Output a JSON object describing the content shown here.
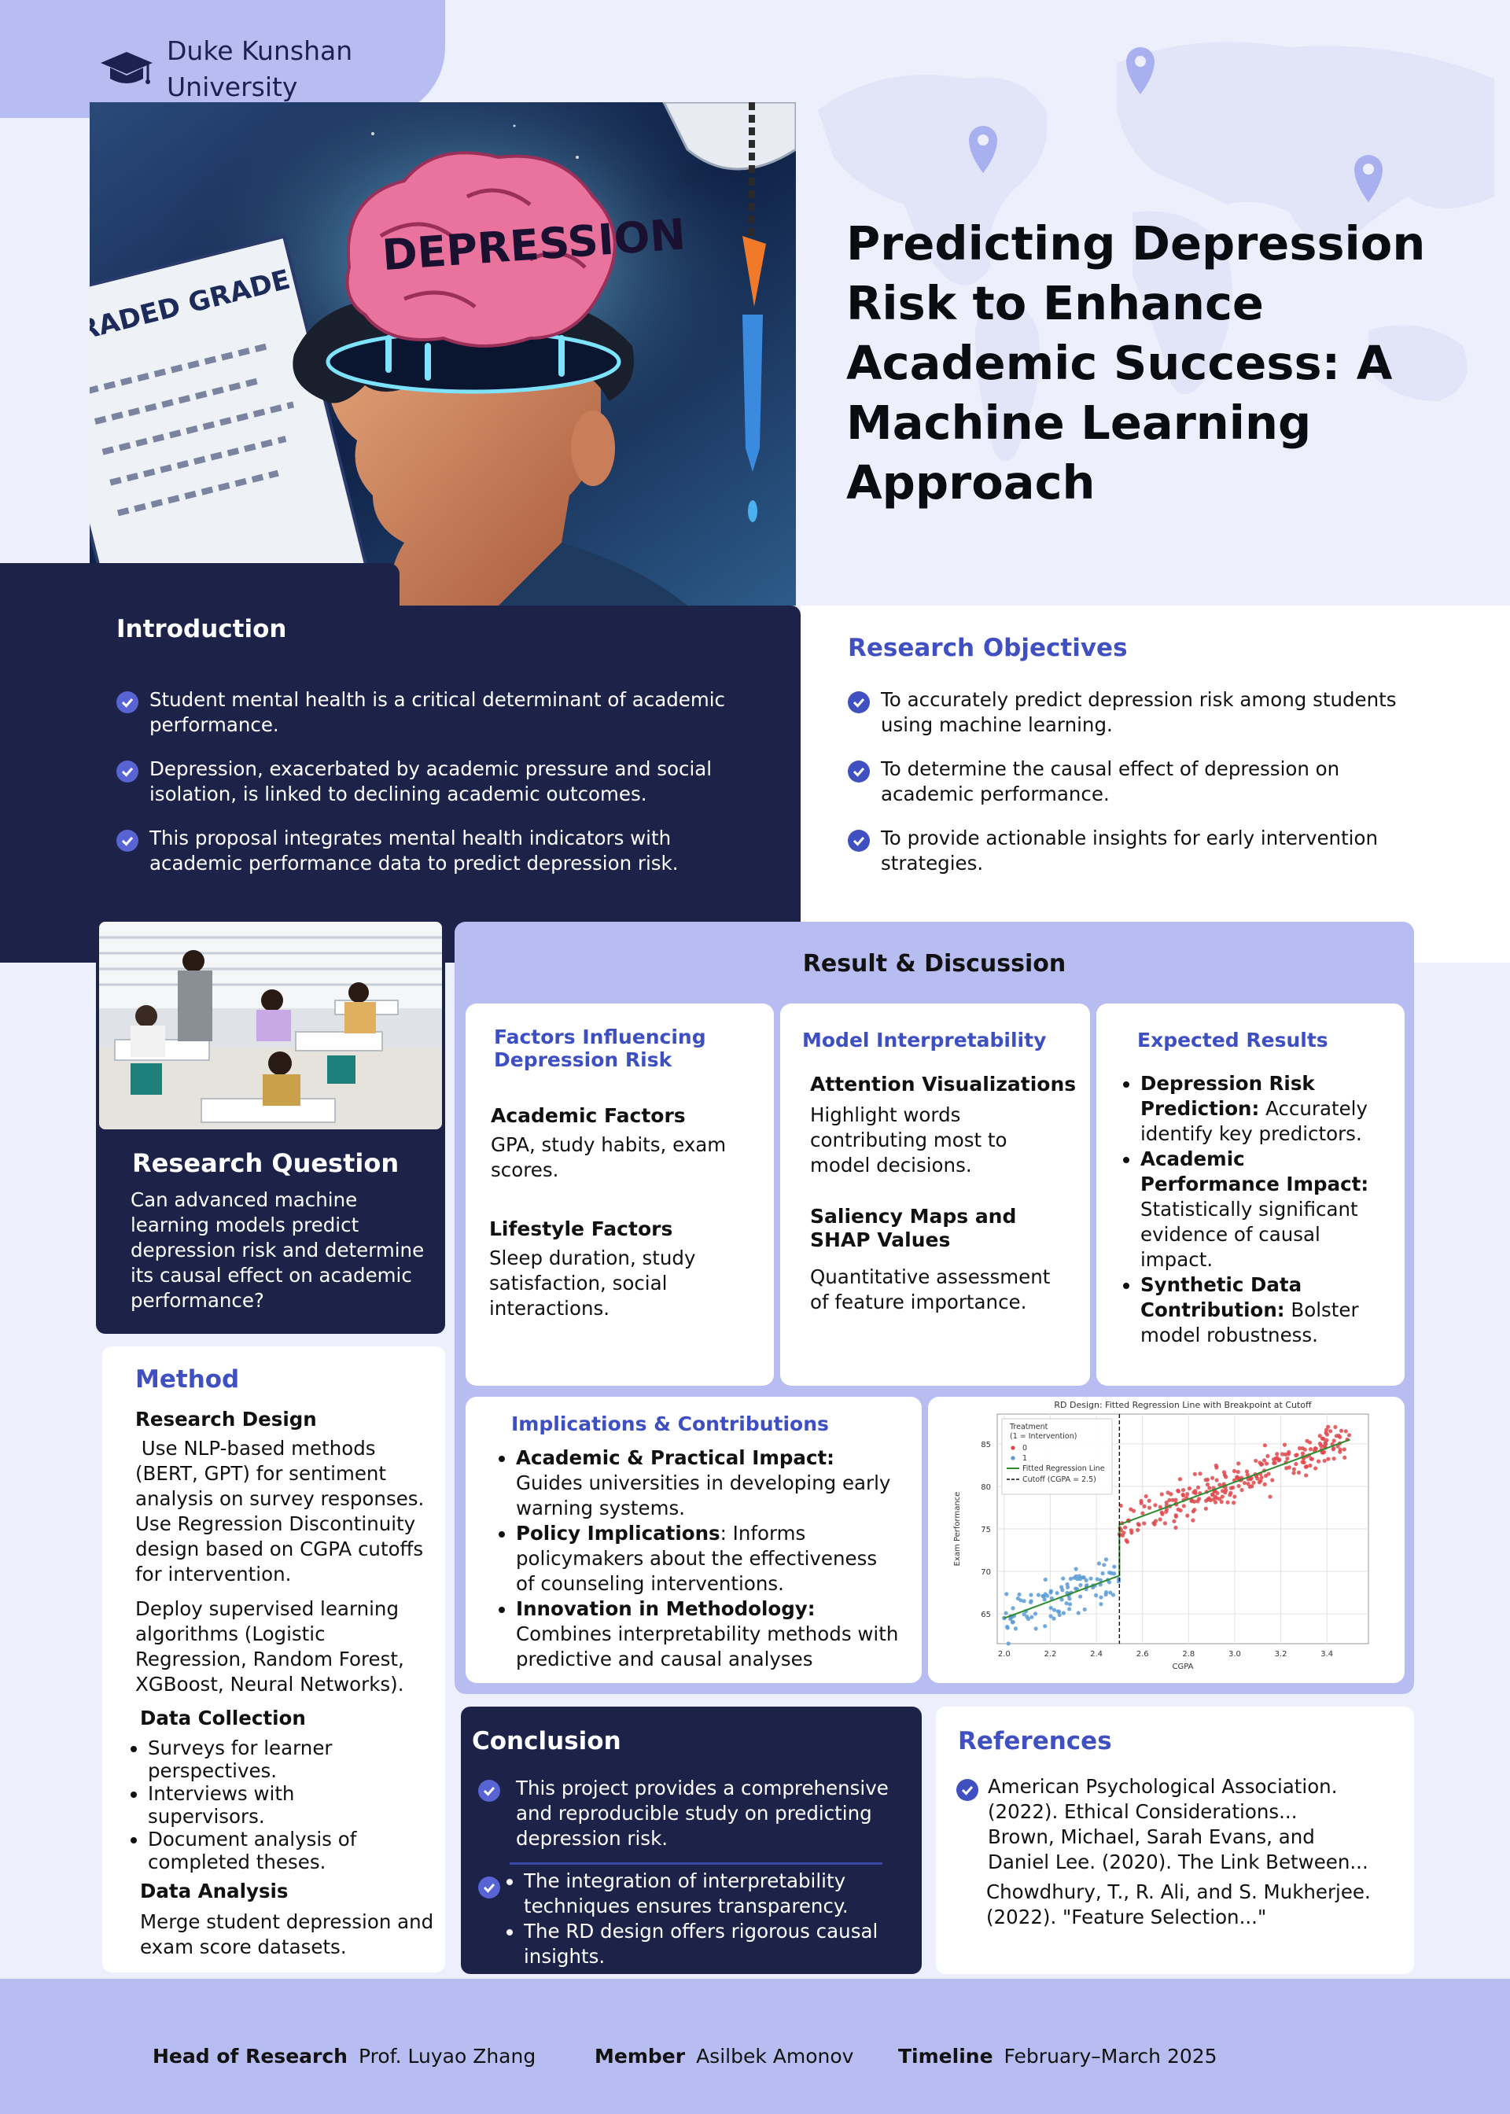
{
  "header": {
    "university_line1": "Duke Kunshan",
    "university_line2": "University",
    "title": "Predicting Depression Risk to Enhance Academic Success: A Machine Learning Approach"
  },
  "hero_image": {
    "text_depression": "DEPRESSION",
    "text_graded": "GRADED GRADE"
  },
  "introduction": {
    "title": "Introduction",
    "items": [
      "Student mental health is a critical determinant of academic performance.",
      "Depression, exacerbated by academic pressure and social isolation, is linked to declining academic outcomes.",
      "This proposal integrates mental health indicators with academic performance data to predict depression risk."
    ]
  },
  "objectives": {
    "title": "Research Objectives",
    "items": [
      "To accurately predict depression risk among students using machine learning.",
      "To determine the causal effect of depression on academic performance.",
      "To provide actionable insights for early intervention strategies."
    ]
  },
  "research_question": {
    "title": "Research Question",
    "text": "Can advanced machine learning models predict depression risk and determine its causal effect on academic performance?"
  },
  "method": {
    "title": "Method",
    "design_title": "Research Design",
    "design_p1": " Use NLP-based methods (BERT, GPT) for sentiment analysis on survey responses. Use Regression Discontinuity design based on CGPA cutoffs for intervention.",
    "design_p2": "Deploy supervised learning algorithms (Logistic Regression, Random Forest, XGBoost, Neural Networks).",
    "collection_title": "Data Collection",
    "collection_items": [
      "Surveys for learner perspectives.",
      "Interviews with supervisors.",
      "Document analysis of completed theses."
    ],
    "analysis_title": "Data Analysis",
    "analysis_text": "Merge student depression and exam score datasets."
  },
  "results": {
    "title": "Result & Discussion",
    "factors": {
      "title": "Factors Influencing Depression Risk",
      "academic_title": "Academic Factors",
      "academic_text": "GPA, study habits, exam scores.",
      "lifestyle_title": "Lifestyle Factors",
      "lifestyle_text": "Sleep duration, study satisfaction, social interactions."
    },
    "interpretability": {
      "title": "Model Interpretability",
      "attention_title": "Attention Visualizations",
      "attention_text": "Highlight words contributing most to model decisions.",
      "saliency_title": "Saliency Maps and SHAP Values",
      "saliency_text": "Quantitative assessment of feature importance."
    },
    "expected": {
      "title": "Expected Results",
      "items": [
        {
          "bold": "Depression Risk Prediction:",
          "text": " Accurately identify key predictors."
        },
        {
          "bold": "Academic Performance Impact:",
          "text": " Statistically significant evidence of causal impact."
        },
        {
          "bold": "Synthetic Data Contribution:",
          "text": " Bolster model robustness."
        }
      ]
    },
    "implications": {
      "title": "Implications & Contributions",
      "items": [
        {
          "bold": "Academic & Practical Impact:",
          "text": " Guides universities in developing early warning systems."
        },
        {
          "bold": "Policy Implications",
          "text": ": Informs policymakers about the effectiveness of counseling interventions."
        },
        {
          "bold": "Innovation in Methodology:",
          "text": " Combines interpretability methods with predictive and causal analyses"
        }
      ]
    }
  },
  "chart_data": {
    "type": "scatter",
    "title": "RD Design: Fitted Regression Line with Breakpoint at Cutoff",
    "xlabel": "CGPA",
    "ylabel": "Exam Performance",
    "xlim": [
      1.97,
      3.58
    ],
    "ylim": [
      61.5,
      88.5
    ],
    "xticks": [
      2.0,
      2.2,
      2.4,
      2.6,
      2.8,
      3.0,
      3.2,
      3.4
    ],
    "yticks": [
      65,
      70,
      75,
      80,
      85
    ],
    "cutoff": 2.5,
    "legend_title": "Treatment\n(1 = Intervention)",
    "legend_items": [
      "0",
      "1",
      "Fitted Regression Line",
      "Cutoff (CGPA = 2.5)"
    ],
    "series": [
      {
        "name": "0",
        "color": "#5b9bd5",
        "x_range": [
          2.0,
          2.5
        ],
        "intercept": 64.5,
        "slope": 9.5
      },
      {
        "name": "1",
        "color": "#e0474c",
        "x_range": [
          2.5,
          3.5
        ],
        "intercept": 75.5,
        "slope": 10.0
      }
    ],
    "fitted_line": [
      [
        2.0,
        64.5
      ],
      [
        2.5,
        69.5
      ],
      [
        2.5,
        75.5
      ],
      [
        3.5,
        85.5
      ]
    ],
    "grid": true,
    "legend_position": "top-left",
    "colors": {
      "fitted": "#2e8b2e",
      "cutoff": "#111111"
    }
  },
  "conclusion": {
    "title": "Conclusion",
    "p1": "This project provides a comprehensive and reproducible study on predicting depression risk.",
    "items": [
      "The integration of interpretability techniques ensures transparency.",
      "The RD design offers rigorous causal insights."
    ]
  },
  "references": {
    "title": "References",
    "items": [
      "American Psychological Association. (2022). Ethical Considerations...",
      "Brown, Michael, Sarah Evans, and Daniel Lee. (2020). The Link Between...",
      "Chowdhury, T., R. Ali, and S. Mukherjee. (2022). \"Feature Selection...\""
    ]
  },
  "footer": {
    "head_label": "Head of Research",
    "head_value": "Prof. Luyao Zhang",
    "member_label": "Member",
    "member_value": "Asilbek Amonov",
    "timeline_label": "Timeline",
    "timeline_value": "February–March 2025"
  },
  "colors": {
    "navy": "#1c2248",
    "lavender": "#b8bdf1",
    "accent": "#4050c0",
    "background": "#eeeffc"
  }
}
